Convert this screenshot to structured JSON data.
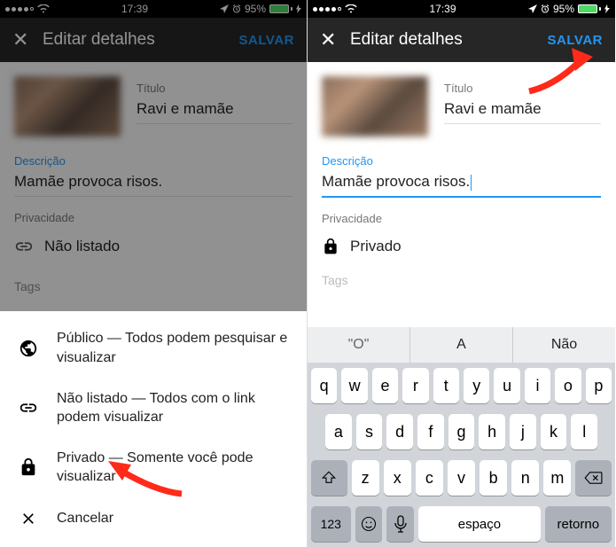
{
  "status": {
    "time": "17:39",
    "battery_pct": "95%"
  },
  "nav": {
    "title": "Editar detalhes",
    "save": "SALVAR"
  },
  "left": {
    "title_label": "Título",
    "title_value": "Ravi e mamãe",
    "desc_label": "Descrição",
    "desc_value": "Mamãe provoca risos.",
    "privacy_label": "Privacidade",
    "privacy_value": "Não listado",
    "tags_label": "Tags"
  },
  "sheet": {
    "public": "Público — Todos podem pesquisar e visualizar",
    "unlisted": "Não listado — Todos com o link podem visualizar",
    "private": "Privado — Somente você pode visualizar",
    "cancel": "Cancelar"
  },
  "right": {
    "title_label": "Título",
    "title_value": "Ravi e mamãe",
    "desc_label": "Descrição",
    "desc_value": "Mamãe provoca risos.",
    "privacy_label": "Privacidade",
    "privacy_value": "Privado",
    "tags_label": "Tags"
  },
  "keyboard": {
    "sug1": "O",
    "sug2": "A",
    "sug3": "Não",
    "row1": [
      "q",
      "w",
      "e",
      "r",
      "t",
      "y",
      "u",
      "i",
      "o",
      "p"
    ],
    "row2": [
      "a",
      "s",
      "d",
      "f",
      "g",
      "h",
      "j",
      "k",
      "l"
    ],
    "row3": [
      "z",
      "x",
      "c",
      "v",
      "b",
      "n",
      "m"
    ],
    "num": "123",
    "space": "espaço",
    "return": "retorno"
  }
}
